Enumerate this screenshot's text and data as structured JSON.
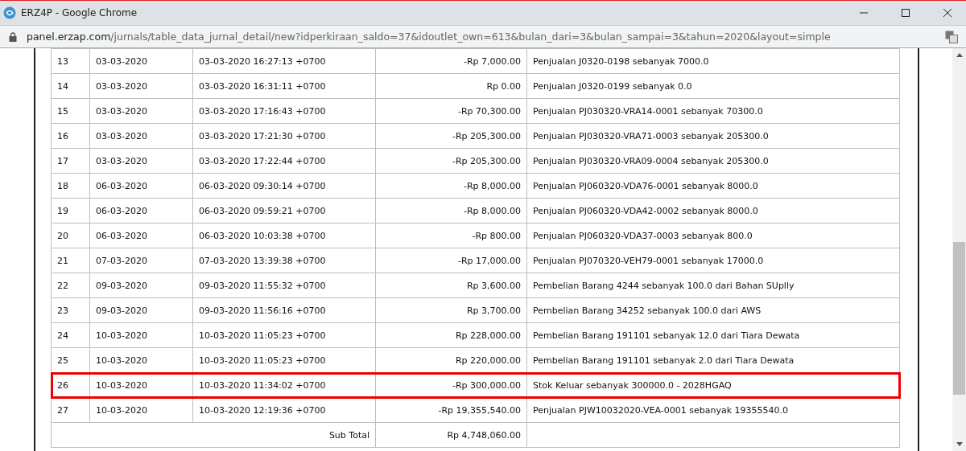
{
  "window": {
    "title": "ERZ4P - Google Chrome"
  },
  "address_bar": {
    "url_host": "panel.erzap.com",
    "url_path": "/jurnals/table_data_jurnal_detail/new?idperkiraan_saldo=37&idoutlet_own=613&bulan_dari=3&bulan_sampai=3&tahun=2020&layout=simple"
  },
  "table": {
    "rows": [
      {
        "no": "13",
        "date": "03-03-2020",
        "datetime": "03-03-2020 16:27:13 +0700",
        "amount": "-Rp 7,000.00",
        "description": "Penjualan J0320-0198 sebanyak 7000.0",
        "highlighted": false
      },
      {
        "no": "14",
        "date": "03-03-2020",
        "datetime": "03-03-2020 16:31:11 +0700",
        "amount": "Rp 0.00",
        "description": "Penjualan J0320-0199 sebanyak 0.0",
        "highlighted": false
      },
      {
        "no": "15",
        "date": "03-03-2020",
        "datetime": "03-03-2020 17:16:43 +0700",
        "amount": "-Rp 70,300.00",
        "description": "Penjualan PJ030320-VRA14-0001 sebanyak 70300.0",
        "highlighted": false
      },
      {
        "no": "16",
        "date": "03-03-2020",
        "datetime": "03-03-2020 17:21:30 +0700",
        "amount": "-Rp 205,300.00",
        "description": "Penjualan PJ030320-VRA71-0003 sebanyak 205300.0",
        "highlighted": false
      },
      {
        "no": "17",
        "date": "03-03-2020",
        "datetime": "03-03-2020 17:22:44 +0700",
        "amount": "-Rp 205,300.00",
        "description": "Penjualan PJ030320-VRA09-0004 sebanyak 205300.0",
        "highlighted": false
      },
      {
        "no": "18",
        "date": "06-03-2020",
        "datetime": "06-03-2020 09:30:14 +0700",
        "amount": "-Rp 8,000.00",
        "description": "Penjualan PJ060320-VDA76-0001 sebanyak 8000.0",
        "highlighted": false
      },
      {
        "no": "19",
        "date": "06-03-2020",
        "datetime": "06-03-2020 09:59:21 +0700",
        "amount": "-Rp 8,000.00",
        "description": "Penjualan PJ060320-VDA42-0002 sebanyak 8000.0",
        "highlighted": false
      },
      {
        "no": "20",
        "date": "06-03-2020",
        "datetime": "06-03-2020 10:03:38 +0700",
        "amount": "-Rp 800.00",
        "description": "Penjualan PJ060320-VDA37-0003 sebanyak 800.0",
        "highlighted": false
      },
      {
        "no": "21",
        "date": "07-03-2020",
        "datetime": "07-03-2020 13:39:38 +0700",
        "amount": "-Rp 17,000.00",
        "description": "Penjualan PJ070320-VEH79-0001 sebanyak 17000.0",
        "highlighted": false
      },
      {
        "no": "22",
        "date": "09-03-2020",
        "datetime": "09-03-2020 11:55:32 +0700",
        "amount": "Rp 3,600.00",
        "description": "Pembelian Barang 4244 sebanyak 100.0 dari Bahan SUplly",
        "highlighted": false
      },
      {
        "no": "23",
        "date": "09-03-2020",
        "datetime": "09-03-2020 11:56:16 +0700",
        "amount": "Rp 3,700.00",
        "description": "Pembelian Barang 34252 sebanyak 100.0 dari AWS",
        "highlighted": false
      },
      {
        "no": "24",
        "date": "10-03-2020",
        "datetime": "10-03-2020 11:05:23 +0700",
        "amount": "Rp 228,000.00",
        "description": "Pembelian Barang 191101 sebanyak 12.0 dari Tiara Dewata",
        "highlighted": false
      },
      {
        "no": "25",
        "date": "10-03-2020",
        "datetime": "10-03-2020 11:05:23 +0700",
        "amount": "Rp 220,000.00",
        "description": "Pembelian Barang 191101 sebanyak 2.0 dari Tiara Dewata",
        "highlighted": false
      },
      {
        "no": "26",
        "date": "10-03-2020",
        "datetime": "10-03-2020 11:34:02 +0700",
        "amount": "-Rp 300,000.00",
        "description": "Stok Keluar sebanyak 300000.0 - 2028HGAQ",
        "highlighted": true
      },
      {
        "no": "27",
        "date": "10-03-2020",
        "datetime": "10-03-2020 12:19:36 +0700",
        "amount": "-Rp 19,355,540.00",
        "description": "Penjualan PJW10032020-VEA-0001 sebanyak 19355540.0",
        "highlighted": false
      }
    ],
    "subtotal": {
      "label": "Sub Total",
      "amount": "Rp 4,748,060.00"
    }
  }
}
